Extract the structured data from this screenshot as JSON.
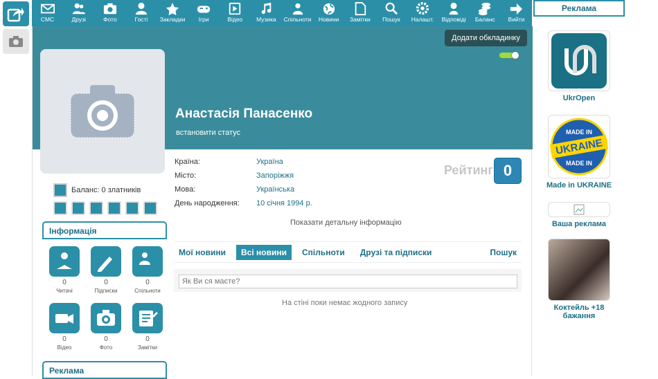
{
  "nav": [
    {
      "label": "СМС",
      "icon": "mail-icon"
    },
    {
      "label": "Друзі",
      "icon": "friends-icon"
    },
    {
      "label": "Фото",
      "icon": "camera-icon"
    },
    {
      "label": "Гості",
      "icon": "guest-icon"
    },
    {
      "label": "Закладки",
      "icon": "star-icon"
    },
    {
      "label": "Ігри",
      "icon": "gamepad-icon"
    },
    {
      "label": "Відео",
      "icon": "play-icon"
    },
    {
      "label": "Музика",
      "icon": "music-icon"
    },
    {
      "label": "Спільноти",
      "icon": "community-icon"
    },
    {
      "label": "Новини",
      "icon": "globe-icon"
    },
    {
      "label": "Замітки",
      "icon": "note-icon"
    },
    {
      "label": "Пошук",
      "icon": "search-icon"
    },
    {
      "label": "Налашт.",
      "icon": "gear-icon"
    },
    {
      "label": "Відповіді",
      "icon": "answers-icon"
    },
    {
      "label": "Баланс",
      "icon": "coins-icon"
    },
    {
      "label": "Вийти",
      "icon": "exit-arrow-icon"
    }
  ],
  "cover": {
    "button_label": "Додати обкладинку"
  },
  "profile": {
    "name": "Анастасія Панасенко",
    "status": "встановити статус",
    "info": [
      {
        "label": "Країна:",
        "value": "Україна"
      },
      {
        "label": "Місто:",
        "value": "Запоріжжя"
      },
      {
        "label": "Мова:",
        "value": "Українська"
      },
      {
        "label": "День народження:",
        "value": "10 січня 1994 р."
      }
    ],
    "rating_label": "Рейтинг",
    "rating_value": "0",
    "details_link": "Показати детальну інформацію"
  },
  "wall": {
    "tabs": [
      "Мої новини",
      "Всі новини",
      "Спільноти",
      "Друзі та підписки",
      "Пошук"
    ],
    "active_tab": 1,
    "input_placeholder": "Як Ви ся маєте?",
    "empty_text": "На стіні поки немає жодного запису"
  },
  "left": {
    "balance_text": "Баланс: 0 златників",
    "info_header": "Інформація",
    "stats": [
      {
        "count": "0",
        "label": "Читачі",
        "icon": "reader-icon"
      },
      {
        "count": "0",
        "label": "Підписки",
        "icon": "subscriptions-icon"
      },
      {
        "count": "0",
        "label": "Спільноти",
        "icon": "community-icon"
      },
      {
        "count": "0",
        "label": "Відео",
        "icon": "video-camera-icon"
      },
      {
        "count": "0",
        "label": "Фото",
        "icon": "photo-camera-icon"
      },
      {
        "count": "0",
        "label": "Замітки",
        "icon": "notepad-icon"
      }
    ],
    "ads_header": "Реклама"
  },
  "right": {
    "header": "Реклама",
    "ads": [
      {
        "caption": "UkrOpen"
      },
      {
        "caption": "Made in UKRAINE",
        "badge_text": [
          "MADE IN",
          "UKRAINE",
          "MADE IN"
        ]
      },
      {
        "caption": "Ваша реклама"
      },
      {
        "caption": "Коктейль +18 бажання"
      }
    ]
  },
  "colors": {
    "accent": "#2b8fa8",
    "cover": "#3a8c9c",
    "rating": "#2e86b4"
  }
}
